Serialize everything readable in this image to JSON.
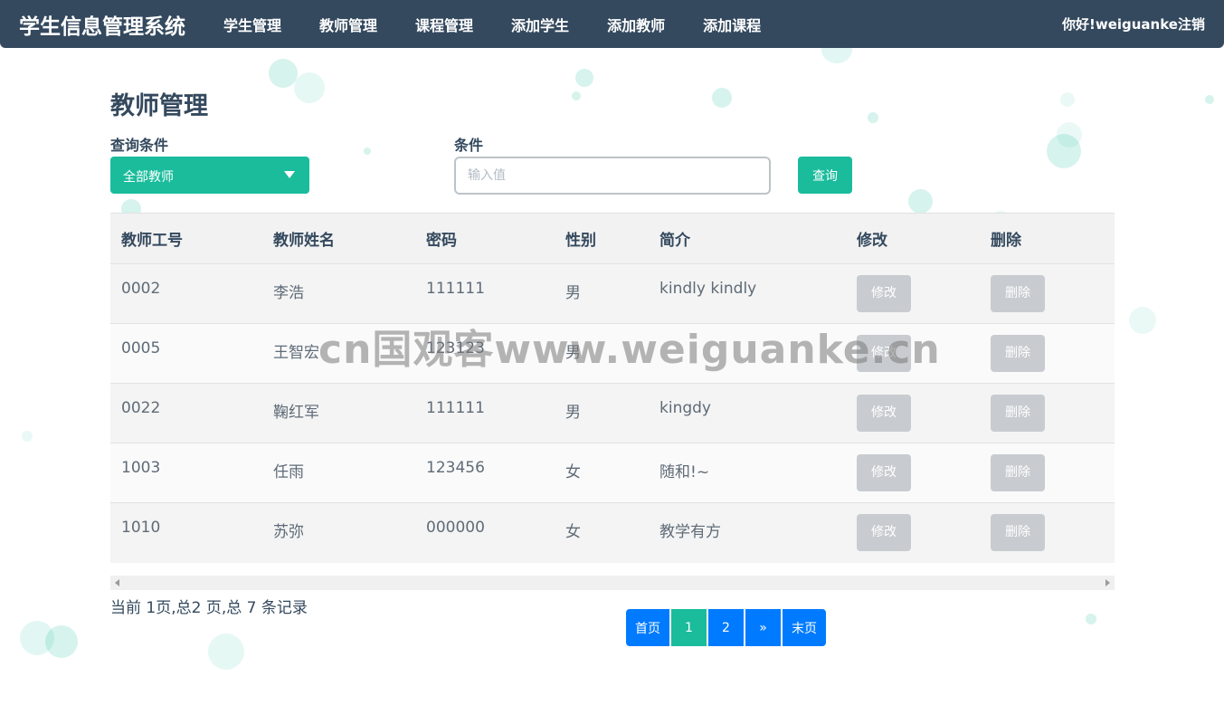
{
  "navbar": {
    "brand": "学生信息管理系统",
    "items": [
      {
        "label": "学生管理"
      },
      {
        "label": "教师管理"
      },
      {
        "label": "课程管理"
      },
      {
        "label": "添加学生"
      },
      {
        "label": "添加教师"
      },
      {
        "label": "添加课程"
      }
    ],
    "greeting": "你好!weiguanke",
    "logout": "注销"
  },
  "page": {
    "title": "教师管理",
    "query_label": "查询条件",
    "condition_label": "条件",
    "select_value": "全部教师",
    "input_placeholder": "输入值",
    "query_button": "查询"
  },
  "table": {
    "headers": [
      "教师工号",
      "教师姓名",
      "密码",
      "性别",
      "简介",
      "修改",
      "删除"
    ],
    "rows": [
      {
        "id": "0002",
        "name": "李浩",
        "password": "111111",
        "gender": "男",
        "intro": "kindly kindly",
        "edit": "修改",
        "delete": "删除"
      },
      {
        "id": "0005",
        "name": "王智宏",
        "password": "123123",
        "gender": "男",
        "intro": "",
        "edit": "修改",
        "delete": "删除"
      },
      {
        "id": "0022",
        "name": "鞠红军",
        "password": "111111",
        "gender": "男",
        "intro": "kingdy",
        "edit": "修改",
        "delete": "删除"
      },
      {
        "id": "1003",
        "name": "任雨",
        "password": "123456",
        "gender": "女",
        "intro": "随和!~",
        "edit": "修改",
        "delete": "删除"
      },
      {
        "id": "1010",
        "name": "苏弥",
        "password": "000000",
        "gender": "女",
        "intro": "教学有方",
        "edit": "修改",
        "delete": "删除"
      }
    ]
  },
  "footer": {
    "page_info": "当前 1页,总2 页,总 7 条记录"
  },
  "pagination": {
    "first": "首页",
    "pages": [
      "1",
      "2"
    ],
    "next": "»",
    "last": "末页"
  },
  "watermark": "cn国观客www.weiguanke.cn",
  "colors": {
    "navbar": "#34495e",
    "accent": "#1abc9c",
    "pager": "#007bff",
    "button_gray": "#c8ccd0"
  }
}
